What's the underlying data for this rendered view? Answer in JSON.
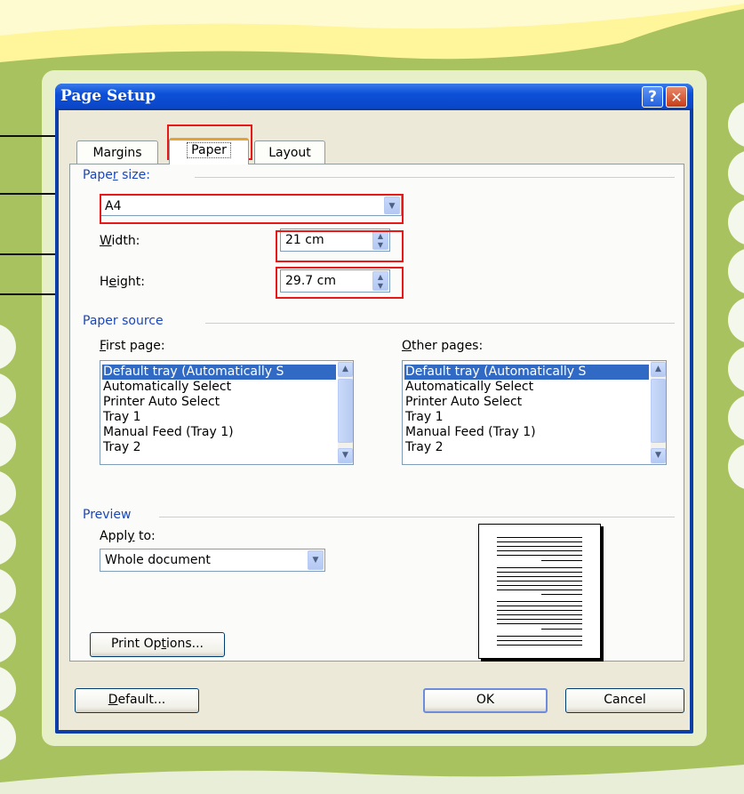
{
  "dialog": {
    "title": "Page Setup",
    "help_glyph": "?",
    "close_glyph": "✕"
  },
  "tabs": [
    {
      "label": "Margins",
      "active": false
    },
    {
      "label": "Paper",
      "active": true
    },
    {
      "label": "Layout",
      "active": false
    }
  ],
  "paper_size": {
    "group_label_pre": "Pape",
    "group_label_u": "r",
    "group_label_post": " size:",
    "selected": "A4",
    "width_label_u": "W",
    "width_label_rest": "idth:",
    "width_value": "21 cm",
    "height_label_pre": "H",
    "height_label_u": "e",
    "height_label_post": "ight:",
    "height_value": "29.7 cm"
  },
  "paper_source": {
    "group_label": "Paper source",
    "first_page_label_u": "F",
    "first_page_label_rest": "irst page:",
    "other_pages_label_u": "O",
    "other_pages_label_rest": "ther pages:",
    "first_page_items": [
      "Default tray (Automatically S",
      "Automatically Select",
      "Printer Auto Select",
      "Tray 1",
      "Manual Feed (Tray 1)",
      "Tray 2"
    ],
    "other_pages_items": [
      "Default tray (Automatically S",
      "Automatically Select",
      "Printer Auto Select",
      "Tray 1",
      "Manual Feed (Tray 1)",
      "Tray 2"
    ],
    "selected_index": 0
  },
  "preview": {
    "group_label": "Preview",
    "apply_to_label_pre": "Appl",
    "apply_to_label_u": "y",
    "apply_to_label_post": " to:",
    "apply_to_value": "Whole document"
  },
  "buttons": {
    "print_options_pre": "Print Op",
    "print_options_u": "t",
    "print_options_post": "ions...",
    "default_u": "D",
    "default_rest": "efault...",
    "ok": "OK",
    "cancel": "Cancel"
  },
  "icons": {
    "dropdown": "chevron-down-icon",
    "spinner": "spinner-updown-icon",
    "scroll_up": "chevron-up-icon",
    "scroll_down": "chevron-down-icon"
  },
  "colors": {
    "title_bar": "#0d51d8",
    "selection": "#316ac5",
    "group_label": "#1a46b8",
    "callout_box": "#e81818",
    "background": "#a6c060"
  }
}
